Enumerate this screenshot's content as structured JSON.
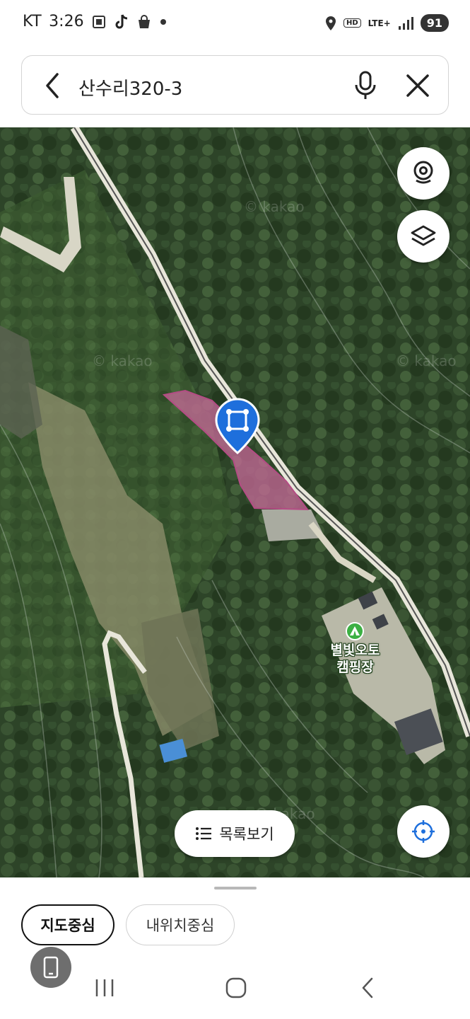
{
  "status_bar": {
    "carrier": "KT",
    "time": "3:26",
    "hd": "HD",
    "network": "LTE+",
    "battery": "91",
    "icons": [
      "screenshot-icon",
      "tiktok-icon",
      "shopping-bag-icon",
      "dot-icon",
      "location-icon",
      "signal-icon"
    ]
  },
  "search": {
    "query": "산수리320-3",
    "back_icon": "back-arrow-icon",
    "mic_icon": "microphone-icon",
    "clear_icon": "close-icon"
  },
  "map": {
    "watermarks": [
      "© kakao",
      "© kakao",
      "© kakao",
      "© kakao"
    ],
    "poi": {
      "name_line1": "별빛오토",
      "name_line2": "캠핑장",
      "icon": "campsite-icon"
    },
    "parcel_color": "#c8699a",
    "marker_color": "#1e6fdc",
    "buttons": {
      "roadview_icon": "roadview-camera-icon",
      "layers_icon": "layers-icon",
      "locate_icon": "crosshair-icon"
    },
    "list_button_label": "목록보기"
  },
  "bottom_sheet": {
    "chip_map_center": "지도중심",
    "chip_my_location": "내위치중심"
  },
  "nav_bar": {
    "recent_icon": "recent-apps-icon",
    "home_icon": "home-icon",
    "back_icon": "nav-back-icon"
  }
}
